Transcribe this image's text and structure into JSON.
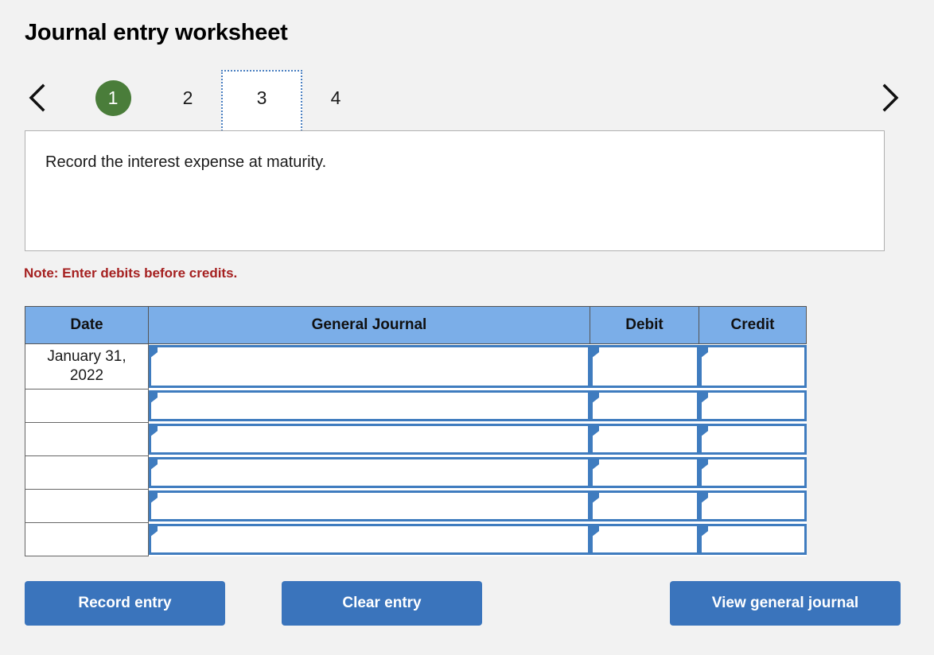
{
  "header": {
    "title": "Journal entry worksheet"
  },
  "nav": {
    "prev_icon": "chevron-left-icon",
    "next_icon": "chevron-right-icon",
    "tabs": [
      {
        "label": "1",
        "state": "completed"
      },
      {
        "label": "2",
        "state": "default"
      },
      {
        "label": "3",
        "state": "selected"
      },
      {
        "label": "4",
        "state": "default"
      }
    ]
  },
  "instruction": {
    "text": "Record the interest expense at maturity."
  },
  "note": {
    "text": "Note: Enter debits before credits."
  },
  "table": {
    "columns": [
      "Date",
      "General Journal",
      "Debit",
      "Credit"
    ],
    "rows": [
      {
        "date": "January 31, 2022",
        "general_journal": "",
        "debit": "",
        "credit": ""
      },
      {
        "date": "",
        "general_journal": "",
        "debit": "",
        "credit": ""
      },
      {
        "date": "",
        "general_journal": "",
        "debit": "",
        "credit": ""
      },
      {
        "date": "",
        "general_journal": "",
        "debit": "",
        "credit": ""
      },
      {
        "date": "",
        "general_journal": "",
        "debit": "",
        "credit": ""
      },
      {
        "date": "",
        "general_journal": "",
        "debit": "",
        "credit": ""
      }
    ]
  },
  "buttons": {
    "record": "Record entry",
    "clear": "Clear entry",
    "view": "View general journal"
  },
  "colors": {
    "page_background": "#f2f2f2",
    "header_blue": "#7baee8",
    "button_blue": "#3a74bc",
    "completed_green": "#4a7d3a",
    "note_red": "#a52020",
    "field_border_blue": "#3f7cbf",
    "focus_dotted_blue": "#4a7fc1"
  }
}
